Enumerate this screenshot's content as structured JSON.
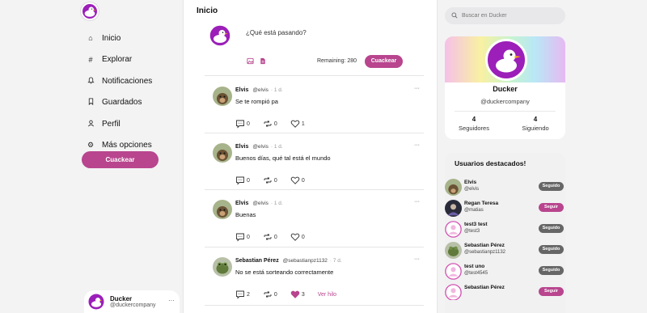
{
  "nav": {
    "items": [
      {
        "label": "Inicio",
        "icon": "home-icon"
      },
      {
        "label": "Explorar",
        "icon": "hashtag-icon"
      },
      {
        "label": "Notificaciones",
        "icon": "bell-icon"
      },
      {
        "label": "Guardados",
        "icon": "bookmark-icon"
      },
      {
        "label": "Perfil",
        "icon": "user-icon"
      },
      {
        "label": "Más opciones",
        "icon": "gear-icon"
      }
    ],
    "cta": "Cuackear",
    "me": {
      "name": "Ducker",
      "handle": "@duckercompany"
    }
  },
  "feed": {
    "title": "Inicio",
    "compose": {
      "placeholder": "¿Qué está pasando?",
      "remaining": "Remaining: 280",
      "button": "Cuackear"
    },
    "posts": [
      {
        "name": "Elvis",
        "handle": "@elvis",
        "time": "· 1 d.",
        "text": "Se te rompió pa",
        "replies": "0",
        "reposts": "0",
        "likes": "1",
        "liked": false,
        "avatar": "dog"
      },
      {
        "name": "Elvis",
        "handle": "@elvis",
        "time": "· 1 d.",
        "text": "Buenos días, qué tal está el mundo",
        "replies": "0",
        "reposts": "0",
        "likes": "0",
        "liked": false,
        "avatar": "dog"
      },
      {
        "name": "Elvis",
        "handle": "@elvis",
        "time": "· 1 d.",
        "text": "Buenas",
        "replies": "0",
        "reposts": "0",
        "likes": "0",
        "liked": false,
        "avatar": "dog"
      },
      {
        "name": "Sebastian Pérez",
        "handle": "@sebastianpz1132",
        "time": "· 7 d.",
        "text": "No se está sorteando correctamente",
        "replies": "2",
        "reposts": "0",
        "likes": "3",
        "liked": true,
        "thread": "Ver hilo",
        "avatar": "frog"
      }
    ]
  },
  "right": {
    "search_placeholder": "Buscar en Ducker",
    "profile": {
      "name": "Ducker",
      "handle": "@duckercompany",
      "followers": "4",
      "followers_label": "Seguidores",
      "following": "4",
      "following_label": "Siguiendo"
    },
    "featured_title": "Usuarios destacados!",
    "featured": [
      {
        "name": "Elvis",
        "handle": "@elvis",
        "button": "Seguido",
        "style": "gray",
        "avatar": "dog"
      },
      {
        "name": "Regan Teresa",
        "handle": "@matias",
        "button": "Seguir",
        "style": "pink",
        "avatar": "dark"
      },
      {
        "name": "test3 test",
        "handle": "@test3",
        "button": "Seguido",
        "style": "gray",
        "avatar": "default"
      },
      {
        "name": "Sebastian Pérez",
        "handle": "@sebastianpz1132",
        "button": "Seguido",
        "style": "gray",
        "avatar": "frog"
      },
      {
        "name": "test uno",
        "handle": "@test4545",
        "button": "Seguido",
        "style": "gray",
        "avatar": "default"
      },
      {
        "name": "Sebastian Pérez",
        "handle": "",
        "button": "Seguir",
        "style": "pink",
        "avatar": "default"
      }
    ]
  },
  "colors": {
    "accent": "#b8458e",
    "brand": "#9b1fb8"
  }
}
